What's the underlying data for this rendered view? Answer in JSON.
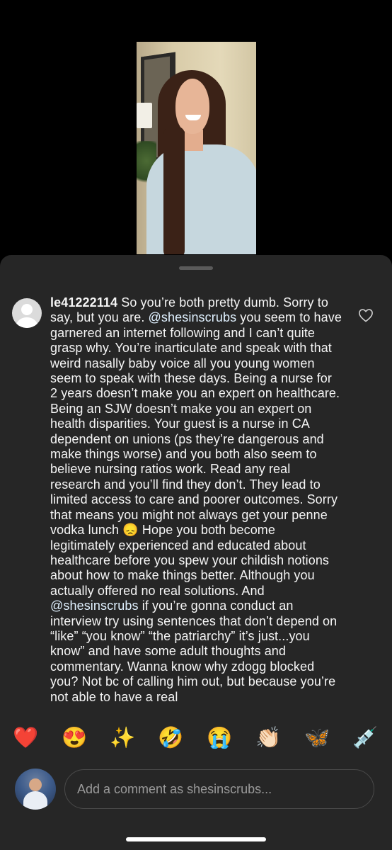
{
  "comment": {
    "username": "le41222114",
    "segments": [
      {
        "type": "text",
        "value": " So you’re both pretty dumb. Sorry to say, but you are. "
      },
      {
        "type": "mention",
        "value": "@shesinscrubs"
      },
      {
        "type": "text",
        "value": "  you seem to have garnered an internet following and I can’t quite grasp why. You’re inarticulate and speak with that weird nasally baby voice all you young women seem to speak with these days. Being a nurse for 2 years doesn’t make you an expert on healthcare. Being an SJW doesn’t make you an expert on health disparities. Your guest is a nurse in CA dependent on unions (ps they’re dangerous and make things worse) and you both also seem to believe nursing ratios work. Read any real research and you’ll find they don’t. They lead to limited access to care and poorer outcomes. Sorry that means you might not always get your penne vodka lunch "
      },
      {
        "type": "emoji",
        "value": "😞"
      },
      {
        "type": "text",
        "value": " Hope you both become legitimately experienced and educated about healthcare before you spew your childish notions about how to make things better. Although you actually offered no real solutions. And "
      },
      {
        "type": "mention",
        "value": "@shesinscrubs"
      },
      {
        "type": "text",
        "value": "  if you’re gonna conduct an interview try using sentences that don’t depend on “like” “you know” “the patriarchy” it’s just...you know” and have some adult thoughts and commentary. Wanna know why zdogg blocked you? Not bc of calling him out, but because you’re not able to have a real"
      }
    ]
  },
  "reactions": [
    "❤️",
    "😍",
    "✨",
    "🤣",
    "😭",
    "👏🏻",
    "🦋",
    "💉"
  ],
  "composer": {
    "placeholder": "Add a comment as shesinscrubs..."
  },
  "icons": {
    "like": "heart-outline-icon",
    "avatar_default": "default-avatar-icon"
  }
}
